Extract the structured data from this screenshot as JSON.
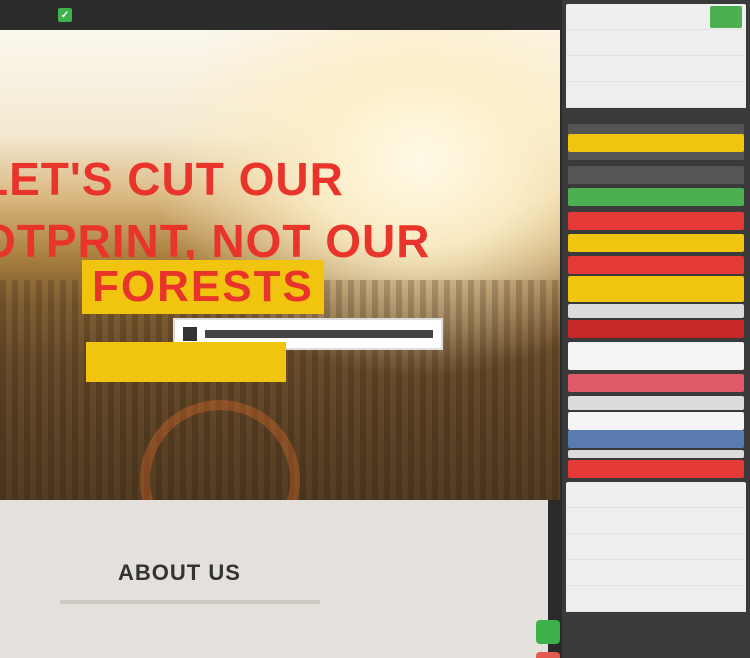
{
  "topbar": {
    "logo_glyph": "✓",
    "site_title": "",
    "menu_label": ""
  },
  "hero": {
    "headline_line1": "LET'S CUT OUR",
    "headline_line2": "OTPRINT, NOT OUR",
    "highlight": "FORESTS",
    "search_placeholder": "",
    "cta_label": ""
  },
  "about": {
    "title": "ABOUT US"
  },
  "panel": {
    "top_items": [
      "",
      "",
      "",
      ""
    ],
    "bottom_items": [
      "",
      "",
      "",
      "",
      ""
    ],
    "colors": {
      "accent_red": "#e8342a",
      "accent_yellow": "#f1c40f",
      "ok_green": "#4caf50"
    }
  }
}
